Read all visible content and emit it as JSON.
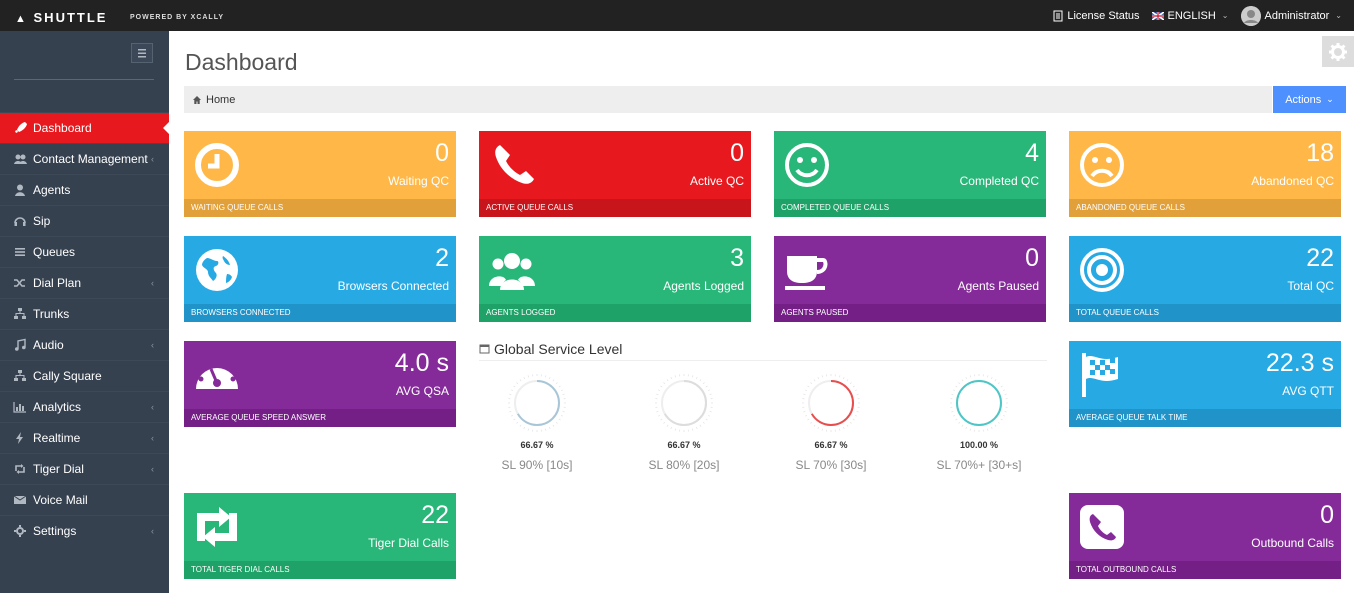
{
  "topbar": {
    "logo": "SHUTTLE",
    "powered": "POWERED BY XCALLY",
    "license": "License Status",
    "language": "ENGLISH",
    "user": "Administrator"
  },
  "sidebar": {
    "items": [
      {
        "label": "Dashboard",
        "icon": "rocket-icon",
        "active": true,
        "submenu": false
      },
      {
        "label": "Contact Management",
        "icon": "users-icon",
        "submenu": true
      },
      {
        "label": "Agents",
        "icon": "user-icon",
        "submenu": false
      },
      {
        "label": "Sip",
        "icon": "headset-icon",
        "submenu": false
      },
      {
        "label": "Queues",
        "icon": "list-icon",
        "submenu": false
      },
      {
        "label": "Dial Plan",
        "icon": "shuffle-icon",
        "submenu": true
      },
      {
        "label": "Trunks",
        "icon": "sitemap-icon",
        "submenu": false
      },
      {
        "label": "Audio",
        "icon": "music-icon",
        "submenu": true
      },
      {
        "label": "Cally Square",
        "icon": "sitemap-icon",
        "submenu": false
      },
      {
        "label": "Analytics",
        "icon": "bar-chart-icon",
        "submenu": true
      },
      {
        "label": "Realtime",
        "icon": "bolt-icon",
        "submenu": true
      },
      {
        "label": "Tiger Dial",
        "icon": "retweet-icon",
        "submenu": true
      },
      {
        "label": "Voice Mail",
        "icon": "envelope-icon",
        "submenu": false
      },
      {
        "label": "Settings",
        "icon": "cog-icon",
        "submenu": true
      }
    ]
  },
  "main": {
    "title": "Dashboard",
    "breadcrumb": "Home",
    "actions": "Actions"
  },
  "tiles": [
    {
      "value": "0",
      "label": "Waiting QC",
      "footer": "WAITING QUEUE CALLS",
      "color": "yellow",
      "icon": "clock-icon"
    },
    {
      "value": "0",
      "label": "Active QC",
      "footer": "ACTIVE QUEUE CALLS",
      "color": "red",
      "icon": "phone-icon"
    },
    {
      "value": "4",
      "label": "Completed QC",
      "footer": "COMPLETED QUEUE CALLS",
      "color": "green",
      "icon": "smile-icon"
    },
    {
      "value": "18",
      "label": "Abandoned QC",
      "footer": "ABANDONED QUEUE CALLS",
      "color": "yellow",
      "icon": "frown-icon"
    },
    {
      "value": "2",
      "label": "Browsers Connected",
      "footer": "BROWSERS CONNECTED",
      "color": "blue",
      "icon": "globe-icon"
    },
    {
      "value": "3",
      "label": "Agents Logged",
      "footer": "AGENTS LOGGED",
      "color": "green",
      "icon": "group-icon"
    },
    {
      "value": "0",
      "label": "Agents Paused",
      "footer": "AGENTS PAUSED",
      "color": "purple",
      "icon": "coffee-icon"
    },
    {
      "value": "22",
      "label": "Total QC",
      "footer": "TOTAL QUEUE CALLS",
      "color": "blue",
      "icon": "bullseye-icon"
    },
    {
      "value": "4.0 s",
      "label": "AVG QSA",
      "footer": "AVERAGE QUEUE SPEED ANSWER",
      "color": "purple",
      "icon": "dashboard-icon"
    },
    {
      "value": "22.3 s",
      "label": "AVG QTT",
      "footer": "AVERAGE QUEUE TALK TIME",
      "color": "blue",
      "icon": "flag-icon"
    },
    {
      "value": "22",
      "label": "Tiger Dial Calls",
      "footer": "TOTAL TIGER DIAL CALLS",
      "color": "green",
      "icon": "retweet-icon"
    },
    {
      "value": "0",
      "label": "Outbound Calls",
      "footer": "TOTAL OUTBOUND CALLS",
      "color": "purple",
      "icon": "phone-square-icon"
    }
  ],
  "gsl": {
    "title": "Global Service Level",
    "gauges": [
      {
        "percent": "66.67 %",
        "label": "SL 90% [10s]",
        "fill": 0.6667,
        "color": "#a9c6d8"
      },
      {
        "percent": "66.67 %",
        "label": "SL 80% [20s]",
        "fill": 0.6667,
        "color": "#dddddd"
      },
      {
        "percent": "66.67 %",
        "label": "SL 70% [30s]",
        "fill": 0.6667,
        "color": "#e84e4e"
      },
      {
        "percent": "100.00 %",
        "label": "SL 70%+ [30+s]",
        "fill": 1.0,
        "color": "#4ec6c6"
      }
    ]
  }
}
